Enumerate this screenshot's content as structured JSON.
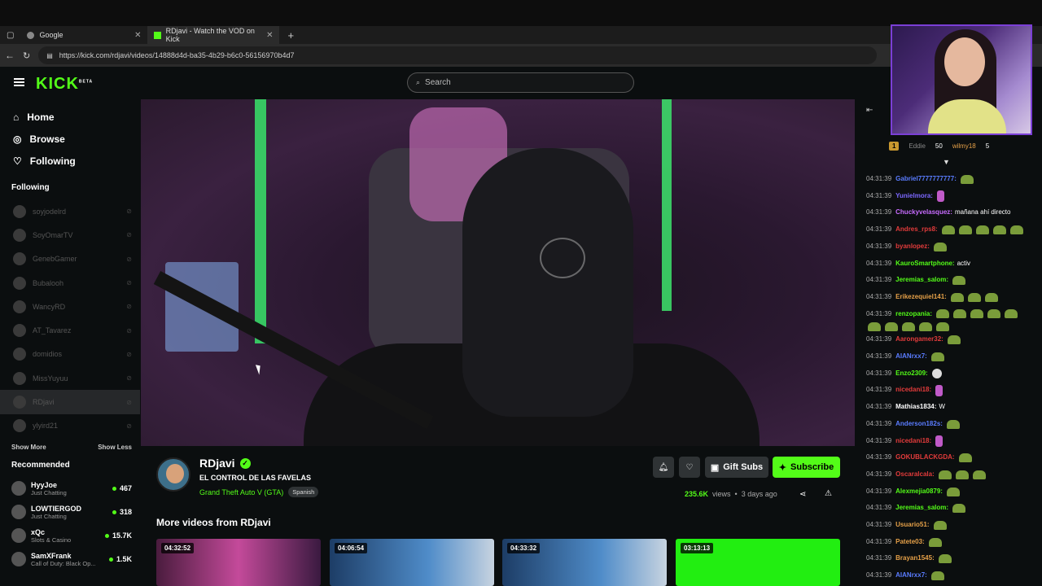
{
  "browser": {
    "tabs": [
      {
        "title": "Google",
        "active": false
      },
      {
        "title": "RDjavi - Watch the VOD on Kick",
        "active": true
      }
    ],
    "url": "https://kick.com/rdjavi/videos/14888d4d-ba35-4b29-b6c0-56156970b4d7"
  },
  "header": {
    "logo": "KICK",
    "logo_badge": "BETA",
    "search_placeholder": "Search"
  },
  "sidebar": {
    "nav": [
      {
        "label": "Home",
        "icon": "home-icon"
      },
      {
        "label": "Browse",
        "icon": "compass-icon"
      },
      {
        "label": "Following",
        "icon": "heart-icon"
      }
    ],
    "following_title": "Following",
    "following": [
      "soyjodelrd",
      "SoyOmarTV",
      "GenebGamer",
      "Bubalooh",
      "WancyRD",
      "AT_Tavarez",
      "domidios",
      "MissYuyuu",
      "RDjavi",
      "ylyird21"
    ],
    "show_more": "Show More",
    "show_less": "Show Less",
    "recommended_title": "Recommended",
    "recommended": [
      {
        "name": "HyyJoe",
        "category": "Just Chatting",
        "viewers": "467"
      },
      {
        "name": "LOWTIERGOD",
        "category": "Just Chatting",
        "viewers": "318"
      },
      {
        "name": "xQc",
        "category": "Slots & Casino",
        "viewers": "15.7K"
      },
      {
        "name": "SamXFrank",
        "category": "Call of Duty: Black Op...",
        "viewers": "1.5K"
      }
    ]
  },
  "video_info": {
    "channel": "RDjavi",
    "title": "EL CONTROL DE LAS FAVELAS",
    "category": "Grand Theft Auto V (GTA)",
    "language": "Spanish",
    "gift_label": "Gift Subs",
    "subscribe_label": "Subscribe",
    "views_value": "235.6K",
    "views_label": "views",
    "age": "3 days ago"
  },
  "more_videos": {
    "title": "More videos from RDjavi",
    "items": [
      {
        "duration": "04:32:52",
        "color": "#8a3a6e"
      },
      {
        "duration": "04:06:54",
        "color": "#3b6ea8"
      },
      {
        "duration": "04:33:32",
        "color": "#3b6ea8"
      },
      {
        "duration": "03:13:13",
        "color": "#22ee11"
      }
    ]
  },
  "chat": {
    "gifters": [
      {
        "badge": "1",
        "count": "50"
      },
      {
        "name": "wilmy18"
      },
      {
        "count": "5"
      }
    ],
    "partial_name": "Eddie",
    "messages": [
      {
        "time": "04:31:39",
        "user": "Gabriel7777777777",
        "color": "#5a7cff",
        "text": "",
        "emotes": [
          "frog"
        ]
      },
      {
        "time": "04:31:39",
        "user": "Yunielmora",
        "color": "#7c68ff",
        "text": "",
        "emotes": [
          "pink"
        ]
      },
      {
        "time": "04:31:39",
        "user": "Chuckyvelasquez",
        "color": "#c86cff",
        "text": "mañana ahí directo",
        "emotes": []
      },
      {
        "time": "04:31:39",
        "user": "Andres_rps8",
        "color": "#e23b3b",
        "text": "",
        "emotes": [
          "frog",
          "frog",
          "frog",
          "frog",
          "frog"
        ]
      },
      {
        "time": "04:31:39",
        "user": "byanlopez",
        "color": "#e23b3b",
        "text": "",
        "emotes": [
          "frog"
        ]
      },
      {
        "time": "04:31:39",
        "user": "KauroSmartphone",
        "color": "#53fc18",
        "text": "activ",
        "emotes": []
      },
      {
        "time": "04:31:39",
        "user": "Jeremias_salom",
        "color": "#53fc18",
        "text": "",
        "emotes": [
          "frog"
        ]
      },
      {
        "time": "04:31:39",
        "user": "Erikezequiel141",
        "color": "#e5a048",
        "text": "",
        "emotes": [
          "frog",
          "frog",
          "frog"
        ]
      },
      {
        "time": "04:31:39",
        "user": "renzopania",
        "color": "#53fc18",
        "text": "",
        "emotes": [
          "frog",
          "frog",
          "frog",
          "frog",
          "frog"
        ]
      },
      {
        "time": "",
        "user": "",
        "color": "#53fc18",
        "text": "",
        "emotes": [
          "frog",
          "frog",
          "frog",
          "frog",
          "frog"
        ]
      },
      {
        "time": "04:31:39",
        "user": "Aarongamer32",
        "color": "#e23b3b",
        "text": "",
        "emotes": [
          "frog"
        ]
      },
      {
        "time": "04:31:39",
        "user": "AIANrxx7",
        "color": "#5a7cff",
        "text": "",
        "emotes": [
          "frog"
        ]
      },
      {
        "time": "04:31:39",
        "user": "Enzo2309",
        "color": "#53fc18",
        "text": "",
        "emotes": [
          "skull"
        ]
      },
      {
        "time": "04:31:39",
        "user": "nicedani18",
        "color": "#e23b3b",
        "text": "",
        "emotes": [
          "pink"
        ]
      },
      {
        "time": "04:31:39",
        "user": "Mathias1834",
        "color": "#ffffff",
        "text": "W",
        "emotes": []
      },
      {
        "time": "04:31:39",
        "user": "Anderson182s",
        "color": "#5a7cff",
        "text": "",
        "emotes": [
          "frog"
        ]
      },
      {
        "time": "04:31:39",
        "user": "nicedani18",
        "color": "#e23b3b",
        "text": "",
        "emotes": [
          "pink"
        ]
      },
      {
        "time": "04:31:39",
        "user": "GOKUBLACKGDA",
        "color": "#e23b3b",
        "text": "",
        "emotes": [
          "frog"
        ]
      },
      {
        "time": "04:31:39",
        "user": "Oscaralcala",
        "color": "#e23b3b",
        "text": "",
        "emotes": [
          "frog",
          "frog",
          "frog"
        ]
      },
      {
        "time": "04:31:39",
        "user": "Alexmejia0879",
        "color": "#53fc18",
        "text": "",
        "emotes": [
          "frog"
        ]
      },
      {
        "time": "04:31:39",
        "user": "Jeremias_salom",
        "color": "#53fc18",
        "text": "",
        "emotes": [
          "frog"
        ]
      },
      {
        "time": "04:31:39",
        "user": "Usuario51",
        "color": "#e5a048",
        "text": "",
        "emotes": [
          "frog"
        ]
      },
      {
        "time": "04:31:39",
        "user": "Patete03",
        "color": "#e5a048",
        "text": "",
        "emotes": [
          "frog"
        ]
      },
      {
        "time": "04:31:39",
        "user": "Brayan1545",
        "color": "#e5a048",
        "text": "",
        "emotes": [
          "frog"
        ]
      },
      {
        "time": "04:31:39",
        "user": "AIANrxx7",
        "color": "#5a7cff",
        "text": "",
        "emotes": [
          "frog"
        ]
      }
    ]
  },
  "colors": {
    "accent": "#53fc18",
    "background": "#0b0e0f",
    "panel": "#2f3335"
  }
}
